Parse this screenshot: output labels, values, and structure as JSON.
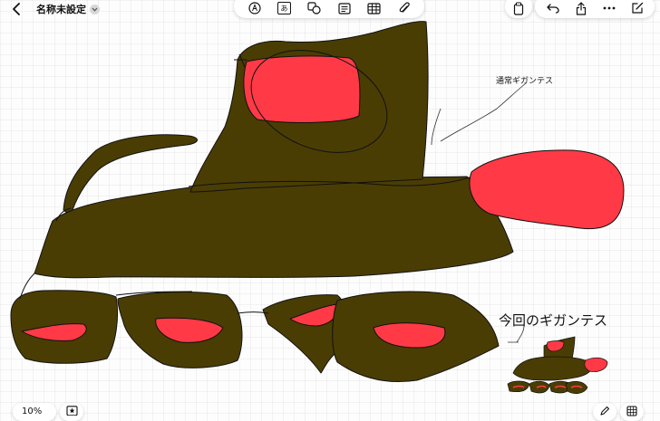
{
  "app": {
    "title": "名称未設定"
  },
  "toolbar": {
    "tools": [
      {
        "icon": "pen-circle-icon",
        "label": ""
      },
      {
        "icon": "text-box-icon",
        "label": "あ"
      },
      {
        "icon": "shapes-icon",
        "label": ""
      },
      {
        "icon": "note-icon",
        "label": ""
      },
      {
        "icon": "table-icon",
        "label": ""
      },
      {
        "icon": "paperclip-icon",
        "label": ""
      }
    ]
  },
  "actions": [
    {
      "icon": "clipboard-icon"
    },
    {
      "icon": "undo-icon"
    },
    {
      "icon": "share-icon"
    },
    {
      "icon": "more-icon"
    },
    {
      "icon": "compose-icon"
    }
  ],
  "canvas": {
    "label_normal": "通常ギガンテス",
    "label_current": "今回のギガンテス",
    "colors": {
      "body": "#4a3d04",
      "eye": "#ff3a46",
      "stroke": "#111111"
    }
  },
  "bottom": {
    "zoom": "10%"
  }
}
